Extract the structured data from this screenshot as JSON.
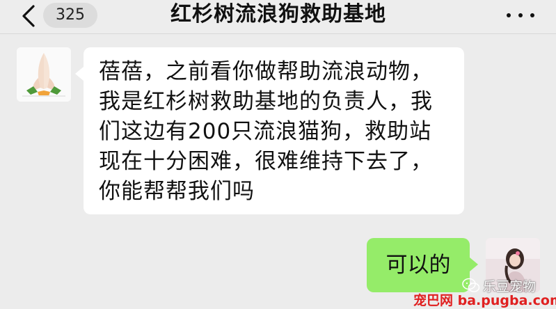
{
  "header": {
    "back_icon": "chevron-left-icon",
    "unread_count": "325",
    "title": "红杉树流浪狗救助基地",
    "more_icon": "more-dots-icon"
  },
  "messages": [
    {
      "side": "left",
      "lines": [
        "蓓蓓，之前看你做帮助流浪动物，",
        "我是红杉树救助基地的负责人，我",
        "们这边有200只流浪猫狗，救助站",
        "现在十分困难，很难维持下去了，",
        "你能帮帮我们吗"
      ]
    },
    {
      "side": "right",
      "text": "可以的"
    }
  ],
  "watermarks": {
    "wechat_label": "乐豆宠物",
    "site_label": "宠巴网 ba.pugba.com"
  },
  "colors": {
    "background": "#ececec",
    "outgoing_bubble": "#95ec69",
    "incoming_bubble": "#ffffff",
    "site_watermark": "#e02020"
  }
}
